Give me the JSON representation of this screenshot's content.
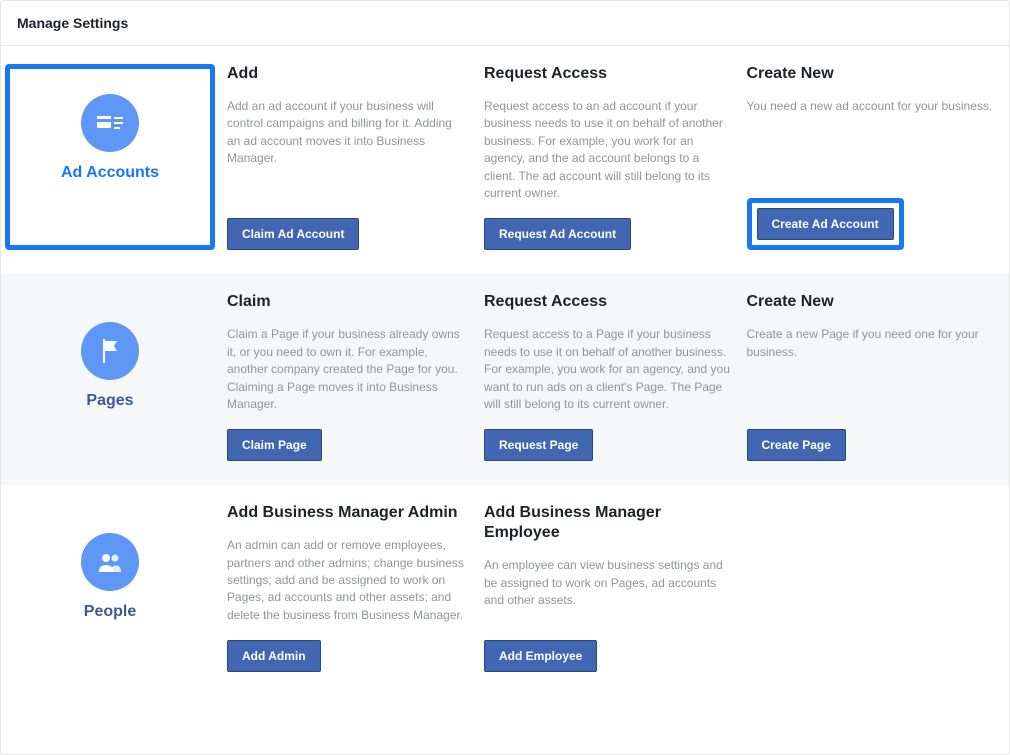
{
  "header": {
    "title": "Manage Settings"
  },
  "sections": [
    {
      "id": "ad-accounts",
      "label": "Ad Accounts",
      "icon": "ad-account",
      "highlight_category": true,
      "cards": [
        {
          "title": "Add",
          "desc": "Add an ad account if your business will control campaigns and billing for it. Adding an ad account moves it into Business Manager.",
          "button": "Claim Ad Account",
          "highlight_button": false
        },
        {
          "title": "Request Access",
          "desc": "Request access to an ad account if your business needs to use it on behalf of another business. For example, you work for an agency, and the ad account belongs to a client. The ad account will still belong to its current owner.",
          "button": "Request Ad Account",
          "highlight_button": false
        },
        {
          "title": "Create New",
          "desc": "You need a new ad account for your business.",
          "button": "Create Ad Account",
          "highlight_button": true
        }
      ]
    },
    {
      "id": "pages",
      "label": "Pages",
      "icon": "flag",
      "highlight_category": false,
      "cards": [
        {
          "title": "Claim",
          "desc": "Claim a Page if your business already owns it, or you need to own it. For example, another company created the Page for you. Claiming a Page moves it into Business Manager.",
          "button": "Claim Page",
          "highlight_button": false
        },
        {
          "title": "Request Access",
          "desc": "Request access to a Page if your business needs to use it on behalf of another business. For example, you work for an agency, and you want to run ads on a client's Page. The Page will still belong to its current owner.",
          "button": "Request Page",
          "highlight_button": false
        },
        {
          "title": "Create New",
          "desc": "Create a new Page if you need one for your business.",
          "button": "Create Page",
          "highlight_button": false
        }
      ]
    },
    {
      "id": "people",
      "label": "People",
      "icon": "people",
      "highlight_category": false,
      "cards": [
        {
          "title": "Add Business Manager Admin",
          "desc": "An admin can add or remove employees, partners and other admins; change business settings; add and be assigned to work on Pages, ad accounts and other assets; and delete the business from Business Manager.",
          "button": "Add Admin",
          "highlight_button": false
        },
        {
          "title": "Add Business Manager Employee",
          "desc": "An employee can view business settings and be assigned to work on Pages, ad accounts and other assets.",
          "button": "Add Employee",
          "highlight_button": false
        }
      ]
    }
  ]
}
